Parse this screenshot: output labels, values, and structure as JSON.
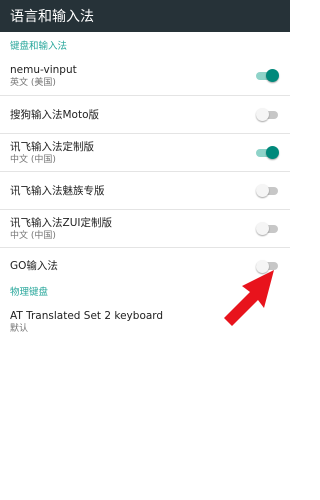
{
  "appbar": {
    "title": "语言和输入法"
  },
  "sections": [
    {
      "header": "键盘和输入法"
    },
    {
      "header": "物理键盘"
    }
  ],
  "keyboards": [
    {
      "title": "nemu-vinput",
      "summary": "英文 (美国)",
      "enabled": true
    },
    {
      "title": "搜狗输入法Moto版",
      "summary": "",
      "enabled": false
    },
    {
      "title": "讯飞输入法定制版",
      "summary": "中文 (中国)",
      "enabled": true
    },
    {
      "title": "讯飞输入法魅族专版",
      "summary": "",
      "enabled": false
    },
    {
      "title": "讯飞输入法ZUI定制版",
      "summary": "中文 (中国)",
      "enabled": false
    },
    {
      "title": "GO输入法",
      "summary": "",
      "enabled": false
    }
  ],
  "physical_keyboard": {
    "title": "AT Translated Set 2 keyboard",
    "summary": "默认"
  },
  "colors": {
    "appbar": "#263238",
    "accent": "#26a69a",
    "switch_on_thumb": "#00897b",
    "arrow": "#e8131c"
  }
}
